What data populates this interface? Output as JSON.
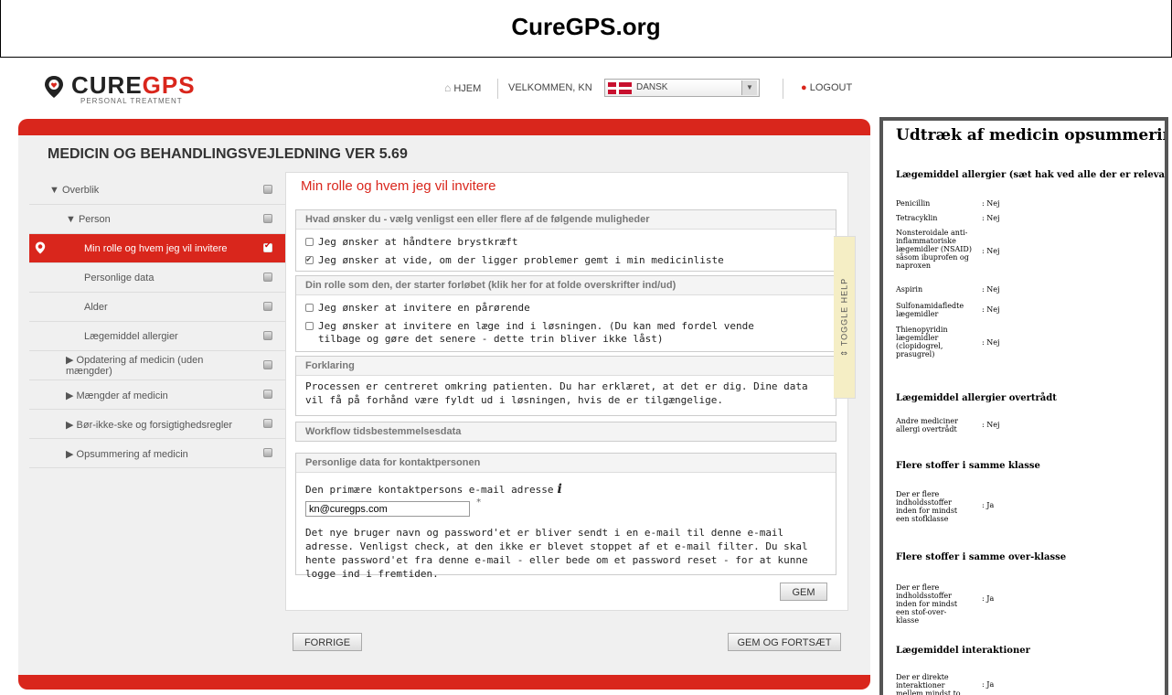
{
  "banner": {
    "title": "CureGPS.org"
  },
  "logo": {
    "brand_part1": "CURE",
    "brand_part2": "GPS",
    "tagline": "PERSONAL TREATMENT"
  },
  "nav": {
    "home": "HJEM",
    "welcome": "VELKOMMEN, KN",
    "language": "DANSK",
    "logout": "LOGOUT"
  },
  "page_title": "MEDICIN OG BEHANDLINGSVEJLEDNING VER 5.69",
  "sidebar": {
    "items": [
      {
        "label": "▼ Overblik"
      },
      {
        "label": "▼ Person"
      },
      {
        "label": "Min rolle og hvem jeg vil invitere"
      },
      {
        "label": "Personlige data"
      },
      {
        "label": "Alder"
      },
      {
        "label": "Lægemiddel allergier"
      },
      {
        "label": "▶ Opdatering af medicin (uden mængder)"
      },
      {
        "label": "▶ Mængder af medicin"
      },
      {
        "label": "▶ Bør-ikke-ske og forsigtighedsregler"
      },
      {
        "label": "▶ Opsummering af medicin"
      }
    ]
  },
  "content": {
    "title": "Min rolle og hvem jeg vil invitere",
    "section1": {
      "header": "Hvad ønsker du - vælg venligst een eller flere af de følgende muligheder",
      "opt1": "Jeg ønsker at håndtere brystkræft",
      "opt2": "Jeg ønsker at vide, om der ligger problemer gemt i min medicinliste"
    },
    "section2": {
      "header": "Din rolle som den, der starter forløbet (klik her for at folde overskrifter ind/ud)",
      "opt1": "Jeg ønsker at invitere en pårørende",
      "opt2": "Jeg ønsker at invitere en læge ind i løsningen. (Du kan med fordel vende tilbage og gøre det senere - dette trin bliver ikke låst)"
    },
    "section3": {
      "header": "Forklaring",
      "text": "Processen er centreret omkring patienten. Du har erklæret, at det er dig. Dine data vil få på forhånd være fyldt ud i løsningen, hvis de er tilgængelige."
    },
    "section4": {
      "header": "Workflow tidsbestemmelsesdata"
    },
    "section5": {
      "header": "Personlige data for kontaktpersonen",
      "email_label": "Den primære kontaktpersons e-mail adresse",
      "info_glyph": "i",
      "email_value": "kn@curegps.com",
      "required_mark": "*",
      "note": "Det nye bruger navn og password'et er bliver sendt i en e-mail til denne e-mail adresse. Venligst check, at den ikke er blevet stoppet af et e-mail filter. Du skal hente password'et fra denne e-mail - eller bede om et password reset - for at kunne logge ind i fremtiden."
    },
    "save": "GEM"
  },
  "toggle_help": "⇕ TOGGLE HELP",
  "footer_buttons": {
    "prev": "FORRIGE",
    "save_continue": "GEM OG FORTSÆT"
  },
  "summary": {
    "title": "Udtræk af medicin opsummering",
    "allergy_header": "Lægemiddel allergier (sæt hak ved alle der er relevante)",
    "allergies": [
      {
        "name": "Penicillin",
        "value": ": Nej"
      },
      {
        "name": "Tetracyklin",
        "value": ": Nej"
      },
      {
        "name": "Nonsteroidale anti-inflammatoriske lægemidler (NSAID) såsom ibuprofen og naproxen",
        "value": ": Nej"
      },
      {
        "name": "Aspirin",
        "value": ": Nej"
      },
      {
        "name": "Sulfonamidafledte lægemidler",
        "value": ": Nej"
      },
      {
        "name": "Thienopyridin lægemidler (clopidogrel, prasugrel)",
        "value": ": Nej"
      }
    ],
    "violated_header": "Lægemiddel allergier overtrådt",
    "violated": {
      "name": "Andre mediciner allergi overtrådt",
      "value": ": Nej"
    },
    "same_class_header": "Flere stoffer i samme klasse",
    "same_class": {
      "name": "Der er flere indholdsstoffer inden for mindst een stofklasse",
      "value": ": Ja"
    },
    "same_superclass_header": "Flere stoffer i samme over-klasse",
    "same_superclass": {
      "name": "Der er flere indholdsstoffer inden for mindst een stof-over-klasse",
      "value": ": Ja"
    },
    "interactions_header": "Lægemiddel interaktioner",
    "interactions": {
      "name": "Der er direkte interaktioner mellem mindst to lægemidler",
      "value": ": Ja"
    }
  },
  "colors": {
    "brand_red": "#d9261c",
    "help_tab": "#f5eec5"
  }
}
